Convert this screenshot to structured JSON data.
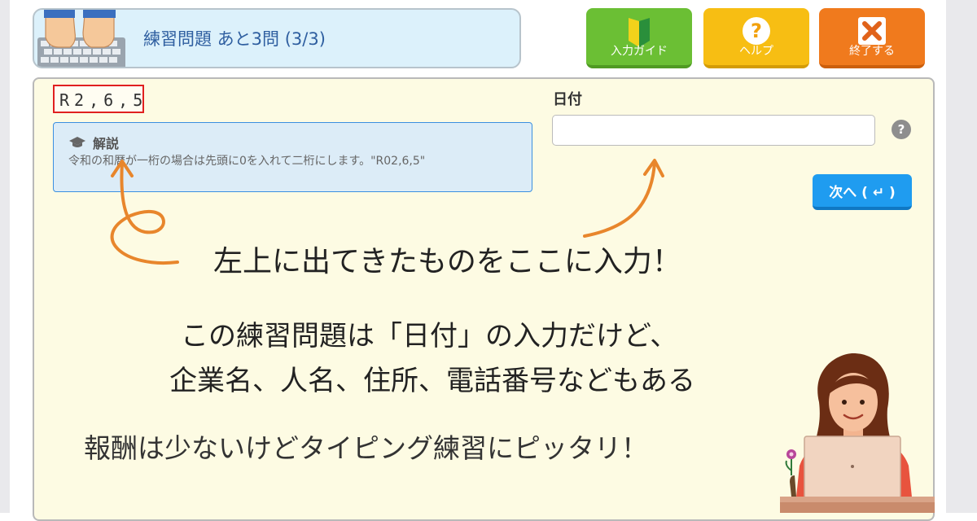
{
  "header": {
    "title": "練習問題 あと3問 (3/3)",
    "buttons": {
      "guide_label": "入力ガイド",
      "help_label": "ヘルプ",
      "quit_label": "終了する"
    }
  },
  "question": {
    "sample_text": "R2,6,5",
    "explanation_title": "解説",
    "explanation_text": "令和の和暦が一桁の場合は先頭に0を入れて二桁にします。\"R02,6,5\"",
    "field_label": "日付",
    "input_value": "",
    "help_mark": "?",
    "next_label": "次へ ( ↵ )"
  },
  "annotations": {
    "line1": "左上に出てきたものをここに入力！",
    "line2": "この練習問題は「日付」の入力だけど、",
    "line3": "企業名、人名、住所、電話番号などもある",
    "line4": "報酬は少ないけどタイピング練習にピッタリ！"
  },
  "colors": {
    "guide": "#6bbf34",
    "help": "#f7be13",
    "quit": "#f07a1d",
    "next": "#1f9cf0",
    "arrow": "#e8862c",
    "panel": "#fdfbe3"
  }
}
